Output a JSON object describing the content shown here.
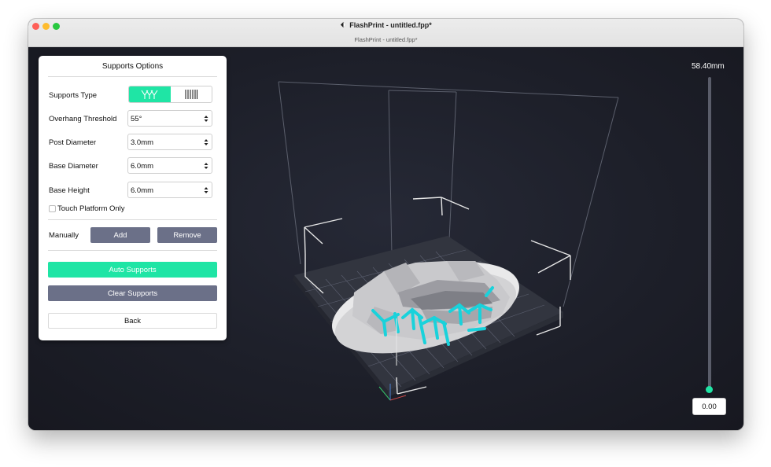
{
  "window": {
    "title": "FlashPrint - untitled.fpp*",
    "document_title": "FlashPrint - untitled.fpp*"
  },
  "panel": {
    "title": "Supports Options",
    "supports_type_label": "Supports Type",
    "supports_type_options": [
      "tree-supports",
      "linear-supports"
    ],
    "supports_type_selected": "tree-supports",
    "overhang_label": "Overhang Threshold",
    "overhang_value": "55°",
    "post_diameter_label": "Post Diameter",
    "post_diameter_value": "3.0mm",
    "base_diameter_label": "Base Diameter",
    "base_diameter_value": "6.0mm",
    "base_height_label": "Base Height",
    "base_height_value": "6.0mm",
    "touch_platform_label": "Touch Platform Only",
    "touch_platform_checked": false,
    "manually_label": "Manually",
    "add_label": "Add",
    "remove_label": "Remove",
    "auto_supports_label": "Auto Supports",
    "clear_supports_label": "Clear Supports",
    "back_label": "Back"
  },
  "slider": {
    "max_label": "58.40mm",
    "current_value": "0.00"
  },
  "colors": {
    "accent": "#1fe5a5",
    "button_gray": "#6b7088",
    "viewport_bg": "#1d1f29",
    "support_cyan": "#19d2db"
  }
}
